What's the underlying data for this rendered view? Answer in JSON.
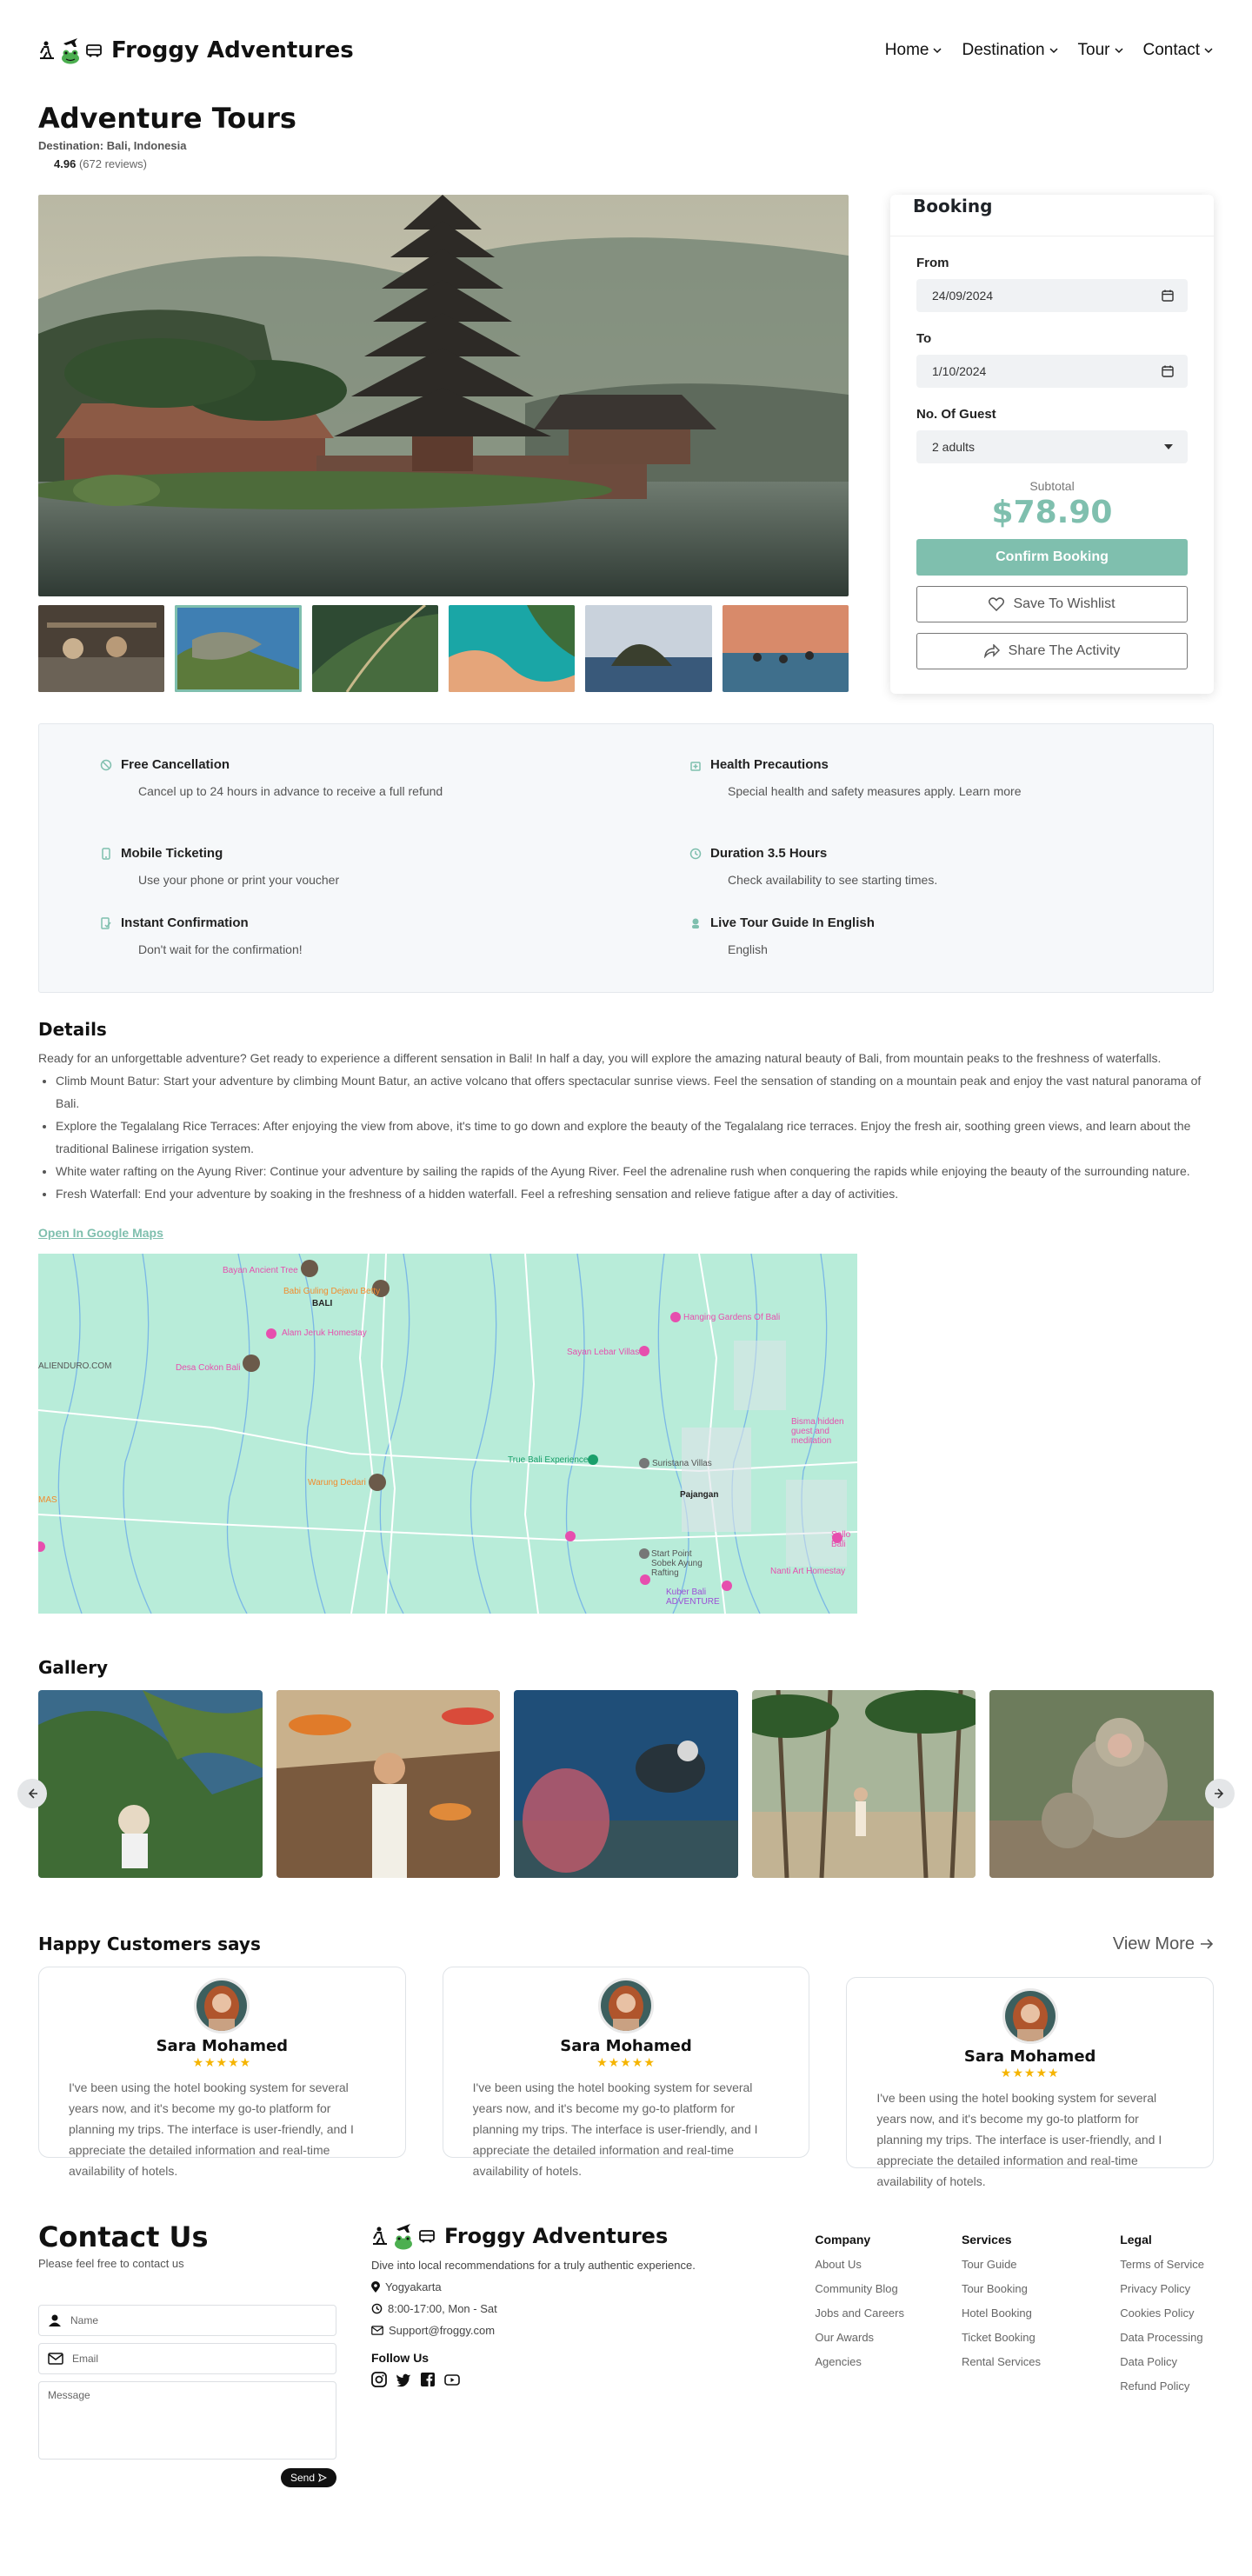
{
  "brand": {
    "name": "Froggy Adventures"
  },
  "nav": [
    {
      "label": "Home"
    },
    {
      "label": "Destination"
    },
    {
      "label": "Tour"
    },
    {
      "label": "Contact"
    }
  ],
  "page": {
    "title": "Adventure Tours",
    "destination": "Destination: Bali, Indonesia",
    "rating": "4.96",
    "reviews": "(672 reviews)"
  },
  "booking": {
    "title": "Booking",
    "from_label": "From",
    "from_value": "24/09/2024",
    "to_label": "To",
    "to_value": "1/10/2024",
    "guests_label": "No. Of Guest",
    "guests_value": "2 adults",
    "subtotal_label": "Subtotal",
    "subtotal_value": "$78.90",
    "confirm": "Confirm Booking",
    "wishlist": "Save To Wishlist",
    "share": "Share The Activity"
  },
  "features": [
    {
      "title": "Free Cancellation",
      "desc": "Cancel up to 24 hours in advance to receive a full refund",
      "icon": "cancel-icon"
    },
    {
      "title": "Health Precautions",
      "desc": "Special health and safety measures apply. Learn more",
      "icon": "health-icon"
    },
    {
      "title": "Mobile Ticketing",
      "desc": "Use your phone or print your voucher",
      "icon": "ticket-icon"
    },
    {
      "title": "Duration 3.5 Hours",
      "desc": "Check availability to see starting times.",
      "icon": "clock-icon"
    },
    {
      "title": "Instant Confirmation",
      "desc": "Don't wait for the confirmation!",
      "icon": "confirmation-icon"
    },
    {
      "title": "Live Tour Guide In English",
      "desc": "English",
      "icon": "guide-icon"
    }
  ],
  "details": {
    "heading": "Details",
    "intro": "Ready for an unforgettable adventure? Get ready to experience a different sensation in Bali! In half a day, you will explore the amazing natural beauty of Bali, from mountain peaks to the freshness of waterfalls.",
    "items": [
      "Climb Mount Batur: Start your adventure by climbing Mount Batur, an active volcano that offers spectacular sunrise views. Feel the sensation of standing on a mountain peak and enjoy the vast natural panorama of Bali.",
      "Explore the Tegalalang Rice Terraces: After enjoying the view from above, it's time to go down and explore the beauty of the Tegalalang rice terraces. Enjoy the fresh air, soothing green views, and learn about the traditional Balinese irrigation system.",
      "White water rafting on the Ayung River: Continue your adventure by sailing the rapids of the Ayung River. Feel the adrenaline rush when conquering the rapids while enjoying the beauty of the surrounding nature.",
      "Fresh Waterfall: End your adventure by soaking in the freshness of a hidden waterfall. Feel a refreshing sensation and relieve fatigue after a day of activities."
    ],
    "maps_link": "Open In Google Maps"
  },
  "map_labels": {
    "a": "Bayan Ancient Tree",
    "b": "Babi Guling Dejavu Betty",
    "c": "BALI",
    "d": "Alam Jeruk Homestay",
    "e": "Desa Cokon Bali",
    "f": "ALIENDURO.COM",
    "g": "Hanging Gardens Of Bali",
    "h": "Sayan Lebar Villas",
    "i": "Bisma hidden guest and meditation",
    "j": "True Bali Experience",
    "k": "Suristana Villas",
    "l": "Pajangan",
    "m": "Warung Dedari",
    "n": "Start Point Sobek Ayung Rafting",
    "o": "Kuber Bali ADVENTURE",
    "p": "Nanti Art Homestay",
    "q": "Sallo Bali",
    "r": "MAS"
  },
  "gallery": {
    "heading": "Gallery"
  },
  "testimonials": {
    "heading": "Happy Customers says",
    "view_more": "View More",
    "cards": [
      {
        "name": "Sara Mohamed",
        "stars": "★★★★★",
        "text": "I've been using the hotel booking system for several years now, and it's become my go-to platform for planning my trips. The interface is user-friendly, and I appreciate the detailed information and real-time availability of hotels."
      },
      {
        "name": "Sara Mohamed",
        "stars": "★★★★★",
        "text": "I've been using the hotel booking system for several years now, and it's become my go-to platform for planning my trips. The interface is user-friendly, and I appreciate the detailed information and real-time availability of hotels."
      },
      {
        "name": "Sara Mohamed",
        "stars": "★★★★★",
        "text": "I've been using the hotel booking system for several years now, and it's become my go-to platform for planning my trips. The interface is user-friendly, and I appreciate the detailed information and real-time availability of hotels."
      }
    ]
  },
  "contact": {
    "heading": "Contact Us",
    "sub": "Please feel free to contact us",
    "name_placeholder": "Name",
    "email_placeholder": "Email",
    "message_placeholder": "Message",
    "send": "Send"
  },
  "footer": {
    "tagline": "Dive into local recommendations for a truly authentic experience.",
    "location": "Yogyakarta",
    "hours": "8:00-17:00, Mon - Sat",
    "email": "Support@froggy.com",
    "follow": "Follow Us",
    "company": {
      "heading": "Company",
      "links": [
        "About Us",
        "Community Blog",
        "Jobs and Careers",
        "Our Awards",
        "Agencies"
      ]
    },
    "services": {
      "heading": "Services",
      "links": [
        "Tour Guide",
        "Tour Booking",
        "Hotel Booking",
        "Ticket Booking",
        "Rental Services"
      ]
    },
    "legal": {
      "heading": "Legal",
      "links": [
        "Terms of Service",
        "Privacy Policy",
        "Cookies Policy",
        "Data Processing",
        "Data Policy",
        "Refund Policy"
      ]
    }
  },
  "colors": {
    "accent": "#7fbfae",
    "star": "#f5b400"
  }
}
